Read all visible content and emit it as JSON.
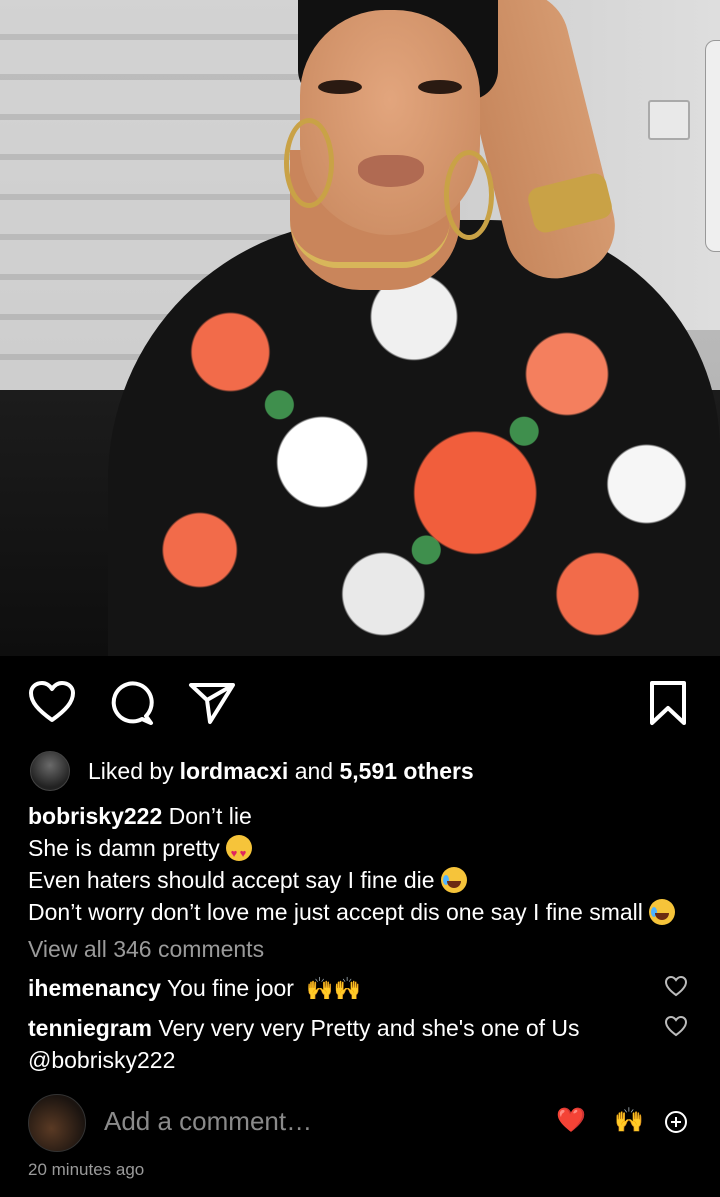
{
  "post": {
    "liked_by_prefix": "Liked by ",
    "liked_by_user": "lordmacxi",
    "liked_by_middle": " and ",
    "liked_by_others": "5,591 others",
    "caption_username": "bobrisky222",
    "caption_lines": [
      "Don’t lie",
      "She is damn pretty",
      "Even haters should accept say I fine die",
      "Don’t worry don’t love me just accept dis one say I fine small"
    ],
    "caption_emojis": [
      "smiling-face-heart-eyes",
      "face-with-tears-of-joy",
      "face-with-tears-of-joy"
    ],
    "view_all_comments": "View all 346 comments",
    "comments": [
      {
        "username": "ihemenancy",
        "text": "You fine joor",
        "emoji": "🙌🙌"
      },
      {
        "username": "tenniegram",
        "text": "Very very very Pretty and she's one of Us",
        "mention": "@bobrisky222"
      }
    ],
    "add_comment_placeholder": "Add a comment…",
    "quick_reactions": [
      "❤️",
      "🙌"
    ],
    "timestamp": "20 minutes ago"
  },
  "icons": {
    "like": "heart-icon",
    "comment": "comment-bubble-icon",
    "share": "paper-plane-icon",
    "save": "bookmark-icon",
    "add_emoji": "plus-circle-icon"
  },
  "colors": {
    "background": "#000000",
    "text": "#ffffff",
    "muted": "#9a9a9a",
    "placeholder": "#8a8a8a",
    "heart_red": "#e0245e"
  }
}
